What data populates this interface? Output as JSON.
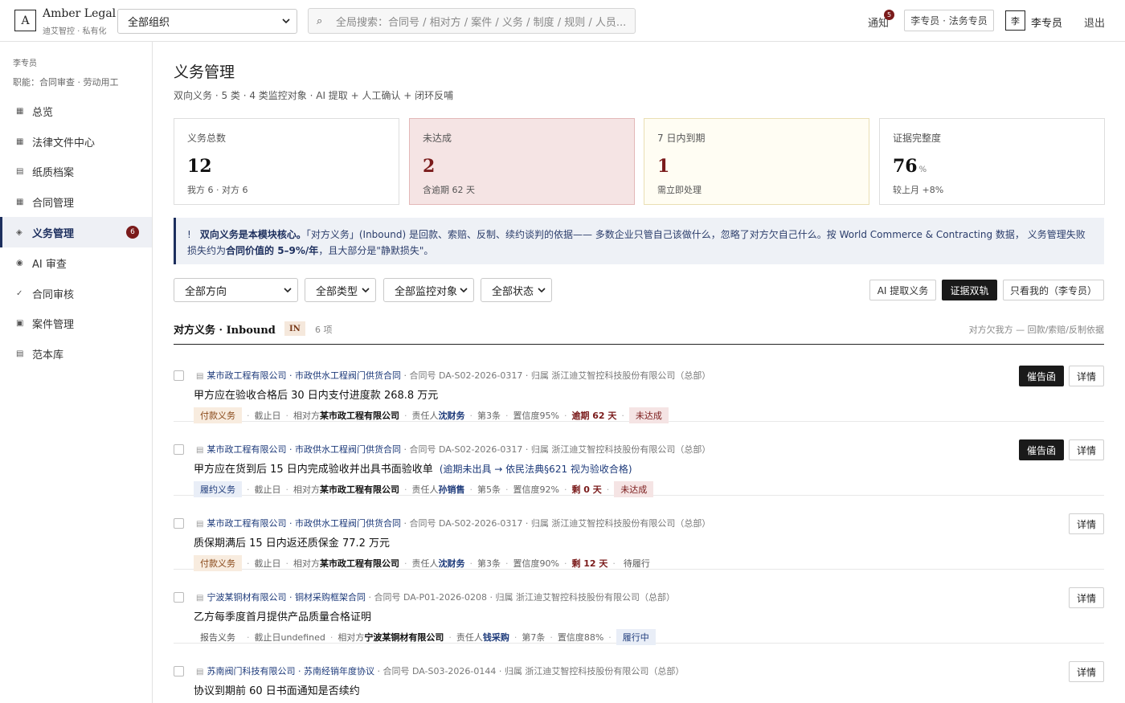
{
  "brand": {
    "logo": "A",
    "title": "Amber Legal",
    "subtitle": "迪艾智控 · 私有化"
  },
  "org_select": {
    "value": "全部组织"
  },
  "search": {
    "placeholder": "全局搜索：合同号 / 相对方 / 案件 / 义务 / 制度 / 规则 / 人员..."
  },
  "header": {
    "notify_label": "通知",
    "notify_count": "5",
    "role_label": "李专员 · 法务专员",
    "avatar": "李",
    "user_name": "李专员",
    "logout": "退出"
  },
  "sidebar": {
    "user": "李专员",
    "role": "职能：合同审查 · 劳动用工",
    "items": [
      {
        "label": "总览",
        "icon": "grid-icon",
        "glyph": "▦"
      },
      {
        "label": "法律文件中心",
        "icon": "grid-icon",
        "glyph": "▦"
      },
      {
        "label": "纸质档案",
        "icon": "list-icon",
        "glyph": "▤"
      },
      {
        "label": "合同管理",
        "icon": "grid-icon",
        "glyph": "▦"
      },
      {
        "label": "义务管理",
        "icon": "diamond-icon",
        "glyph": "◈",
        "badge": "6"
      },
      {
        "label": "AI 审查",
        "icon": "target-icon",
        "glyph": "◉"
      },
      {
        "label": "合同审核",
        "icon": "check-icon",
        "glyph": "✓"
      },
      {
        "label": "案件管理",
        "icon": "square-icon",
        "glyph": "▣"
      },
      {
        "label": "范本库",
        "icon": "list-icon",
        "glyph": "▤"
      }
    ]
  },
  "page": {
    "title": "义务管理",
    "subtitle": "双向义务 · 5 类 · 4 类监控对象 · AI 提取 + 人工确认 + 闭环反哺"
  },
  "stats": [
    {
      "label": "义务总数",
      "value": "12",
      "unit": "",
      "footer": "我方 6 · 对方 6"
    },
    {
      "label": "未达成",
      "value": "2",
      "unit": "",
      "footer": "含逾期 62 天"
    },
    {
      "label": "7 日内到期",
      "value": "1",
      "unit": "",
      "footer": "需立即处理"
    },
    {
      "label": "证据完整度",
      "value": "76",
      "unit": "%",
      "footer": "较上月 +8%"
    }
  ],
  "notice": {
    "bang": "!",
    "bold1": "双向义务是本模块核心。",
    "text1": "「对方义务」(Inbound) 是回款、索赔、反制、续约谈判的依据—— 多数企业只管自己该做什么，忽略了对方欠自己什么。按 World Commerce & Contracting 数据， 义务管理失败损失约为",
    "bold2": "合同价值的 5–9%/年",
    "text2": "，且大部分是\"静默损失\"。"
  },
  "filters": {
    "direction": "全部方向",
    "type": "全部类型",
    "monitor": "全部监控对象",
    "status": "全部状态"
  },
  "toolbar": {
    "ai_extract": "AI 提取义务",
    "evidence": "证据双轨",
    "mine": "只看我的（李专员）"
  },
  "section": {
    "title": "对方义务 · Inbound",
    "tag": "IN",
    "count": "6 项",
    "right": "对方欠我方 — 回款/索赔/反制依据"
  },
  "labels": {
    "contract_no": "合同号",
    "belongs": "归属",
    "deadline": "截止日",
    "counterparty": "相对方",
    "owner": "责任人",
    "confidence": "置信度",
    "remind": "催告函",
    "detail": "详情",
    "doc_icon": "▤"
  },
  "rows": [
    {
      "company": "某市政工程有限公司",
      "contract": "市政供水工程阀门供货合同",
      "no": "DA-S02-2026-0317",
      "owner_org": "浙江迪艾智控科技股份有限公司（总部）",
      "title": "甲方应在验收合格后 30 日内支付进度款 268.8 万元",
      "note": "",
      "type": "付款义务",
      "deadline": "",
      "counterparty": "某市政工程有限公司",
      "owner": "沈财务",
      "clause": "第3条",
      "conf": "95%",
      "days": "逾期 62 天",
      "status": "未达成",
      "remind": true
    },
    {
      "company": "某市政工程有限公司",
      "contract": "市政供水工程阀门供货合同",
      "no": "DA-S02-2026-0317",
      "owner_org": "浙江迪艾智控科技股份有限公司（总部）",
      "title": "甲方应在货到后 15 日内完成验收并出具书面验收单",
      "note": "(逾期未出具 → 依民法典§621 视为验收合格)",
      "type": "履约义务",
      "deadline": "",
      "counterparty": "某市政工程有限公司",
      "owner": "孙销售",
      "clause": "第5条",
      "conf": "92%",
      "days": "剩 0 天",
      "status": "未达成",
      "remind": true
    },
    {
      "company": "某市政工程有限公司",
      "contract": "市政供水工程阀门供货合同",
      "no": "DA-S02-2026-0317",
      "owner_org": "浙江迪艾智控科技股份有限公司（总部）",
      "title": "质保期满后 15 日内返还质保金 77.2 万元",
      "note": "",
      "type": "付款义务",
      "deadline": "",
      "counterparty": "某市政工程有限公司",
      "owner": "沈财务",
      "clause": "第3条",
      "conf": "90%",
      "days": "剩 12 天",
      "status": "待履行",
      "remind": false
    },
    {
      "company": "宁波某铜材有限公司",
      "contract": "铜材采购框架合同",
      "no": "DA-P01-2026-0208",
      "owner_org": "浙江迪艾智控科技股份有限公司（总部）",
      "title": "乙方每季度首月提供产品质量合格证明",
      "note": "",
      "type": "报告义务",
      "deadline": "undefined",
      "counterparty": "宁波某铜材有限公司",
      "owner": "钱采购",
      "clause": "第7条",
      "conf": "88%",
      "days": "",
      "status": "履行中",
      "remind": false
    },
    {
      "company": "苏南阀门科技有限公司",
      "contract": "苏南经销年度协议",
      "no": "DA-S03-2026-0144",
      "owner_org": "浙江迪艾智控科技股份有限公司（总部）",
      "title": "协议到期前 60 日书面通知是否续约",
      "note": "",
      "type": "",
      "deadline": "",
      "counterparty": "",
      "owner": "",
      "clause": "",
      "conf": "",
      "days": "",
      "status": "",
      "remind": false
    }
  ]
}
